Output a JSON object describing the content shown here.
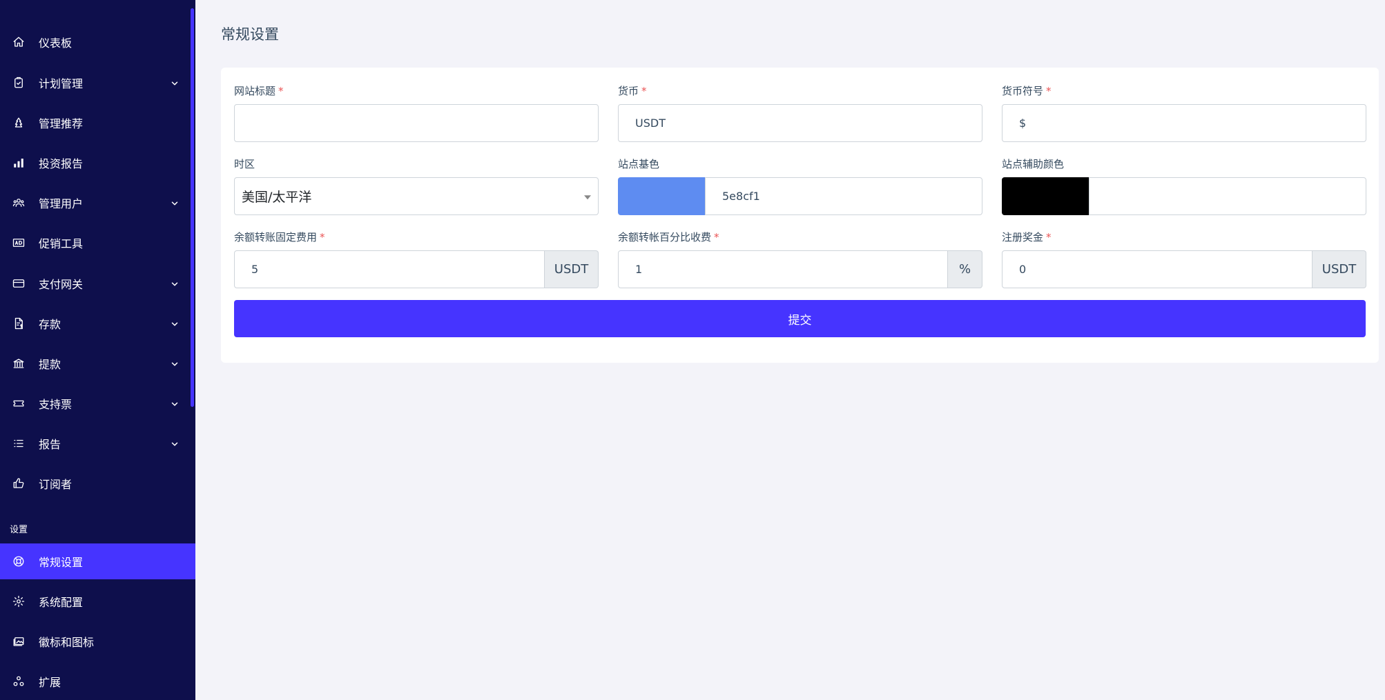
{
  "sidebar": {
    "items": [
      {
        "label": "仪表板",
        "icon": "home-icon"
      },
      {
        "label": "计划管理",
        "icon": "clipboard-check-icon"
      },
      {
        "label": "管理推荐",
        "icon": "tree-icon"
      },
      {
        "label": "投资报告",
        "icon": "bar-chart-icon"
      },
      {
        "label": "管理用户",
        "icon": "users-icon"
      },
      {
        "label": "促销工具",
        "icon": "ad-icon"
      },
      {
        "label": "支付网关",
        "icon": "credit-card-icon"
      },
      {
        "label": "存款",
        "icon": "file-invoice-dollar-icon"
      },
      {
        "label": "提款",
        "icon": "bank-icon"
      },
      {
        "label": "支持票",
        "icon": "ticket-icon"
      },
      {
        "label": "报告",
        "icon": "list-icon"
      },
      {
        "label": "订阅者",
        "icon": "thumbs-up-icon"
      }
    ],
    "section_label": "设置",
    "settings_items": [
      {
        "label": "常规设置",
        "icon": "life-ring-icon",
        "active": true
      },
      {
        "label": "系统配置",
        "icon": "gear-icon"
      },
      {
        "label": "徽标和图标",
        "icon": "images-icon"
      },
      {
        "label": "扩展",
        "icon": "cubes-icon"
      }
    ]
  },
  "page": {
    "title": "常规设置"
  },
  "form": {
    "site_title": {
      "label": "网站标题",
      "required_mark": "*",
      "value": ""
    },
    "currency": {
      "label": "货币",
      "required_mark": "*",
      "value": "USDT"
    },
    "currency_symbol": {
      "label": "货币符号",
      "required_mark": "*",
      "value": "$"
    },
    "timezone": {
      "label": "时区",
      "value": "美国/太平洋"
    },
    "base_color": {
      "label": "站点基色",
      "value": "5e8cf1",
      "swatch": "#5e8cf1"
    },
    "secondary_color": {
      "label": "站点辅助颜色",
      "value": "",
      "swatch": "#000000"
    },
    "fixed_charge": {
      "label": "余额转账固定费用",
      "required_mark": "*",
      "value": "5",
      "addon": "USDT"
    },
    "percent_charge": {
      "label": "余额转帐百分比收费",
      "required_mark": "*",
      "value": "1",
      "addon": "%"
    },
    "registration_bonus": {
      "label": "注册奖金",
      "required_mark": "*",
      "value": "0",
      "addon": "USDT"
    },
    "submit_label": "提交"
  },
  "colors": {
    "sidebar_bg": "#0e0f4c",
    "accent": "#4634ff",
    "required": "#ea5455"
  }
}
